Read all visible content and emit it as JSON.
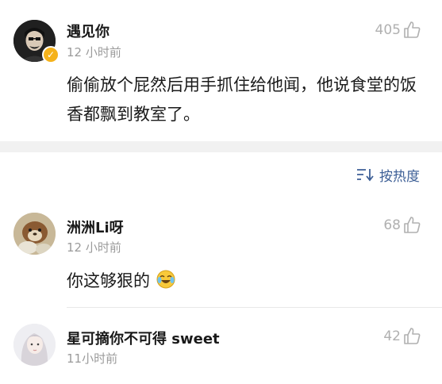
{
  "post": {
    "author": "遇见你",
    "time": "12 小时前",
    "likes": "405",
    "content": "偷偷放个屁然后用手抓住给他闻，他说食堂的饭香都飘到教室了。"
  },
  "sort": {
    "label": "按热度"
  },
  "comments": [
    {
      "author": "洲洲Li呀",
      "time": "12 小时前",
      "likes": "68",
      "content": "你这够狠的"
    },
    {
      "author": "星可摘你不可得 sweet",
      "time": "11小时前",
      "likes": "42"
    }
  ],
  "colors": {
    "accent": "#3d5f96",
    "verified": "#f5b21b"
  }
}
